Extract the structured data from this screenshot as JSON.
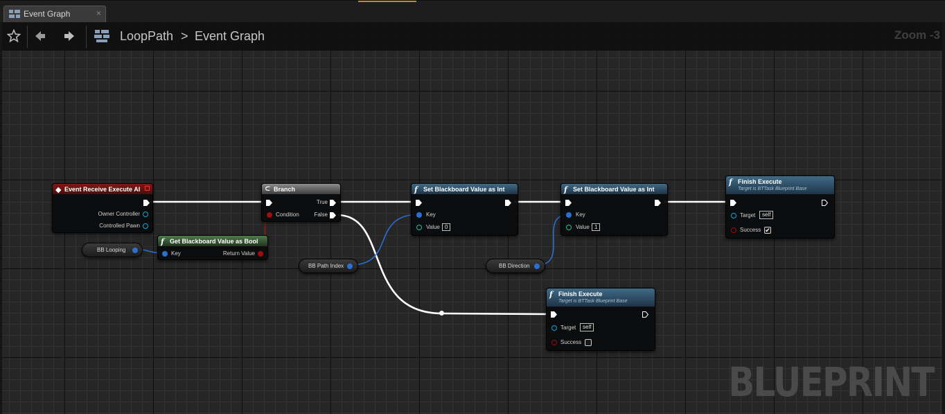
{
  "tab": {
    "label": "Event Graph",
    "close": "×"
  },
  "breadcrumb": {
    "asset": "LoopPath",
    "separator": ">",
    "graph": "Event Graph"
  },
  "zoom": "Zoom -3",
  "watermark": "BLUEPRINT",
  "colors": {
    "exec": "#ffffff",
    "object_pin": "#0ea9d8",
    "name_pin": "#2a6fd1",
    "bool_pin": "#9a0f0f",
    "int_pin": "#1fc69c"
  },
  "nodes": {
    "event": {
      "title": "Event Receive Execute AI",
      "pins": {
        "owner": "Owner Controller",
        "pawn": "Controlled Pawn"
      }
    },
    "branch": {
      "title": "Branch",
      "pins": {
        "true": "True",
        "false": "False",
        "condition": "Condition"
      }
    },
    "set1": {
      "title": "Set Blackboard Value as Int",
      "pins": {
        "key": "Key",
        "value": "Value"
      },
      "value": "0"
    },
    "set2": {
      "title": "Set Blackboard Value as Int",
      "pins": {
        "key": "Key",
        "value": "Value"
      },
      "value": "1"
    },
    "finish1": {
      "title": "Finish Execute",
      "subtitle": "Target is BTTask Blueprint Base",
      "pins": {
        "target": "Target",
        "success": "Success"
      },
      "target_value": "self",
      "success": "✔"
    },
    "finish2": {
      "title": "Finish Execute",
      "subtitle": "Target is BTTask Blueprint Base",
      "pins": {
        "target": "Target",
        "success": "Success"
      },
      "target_value": "self",
      "success": ""
    },
    "getbool": {
      "title": "Get Blackboard Value as Bool",
      "pins": {
        "key": "Key",
        "return": "Return Value"
      }
    },
    "vars": {
      "looping": "BB Looping",
      "path_index": "BB Path Index",
      "direction": "BB Direction"
    }
  }
}
